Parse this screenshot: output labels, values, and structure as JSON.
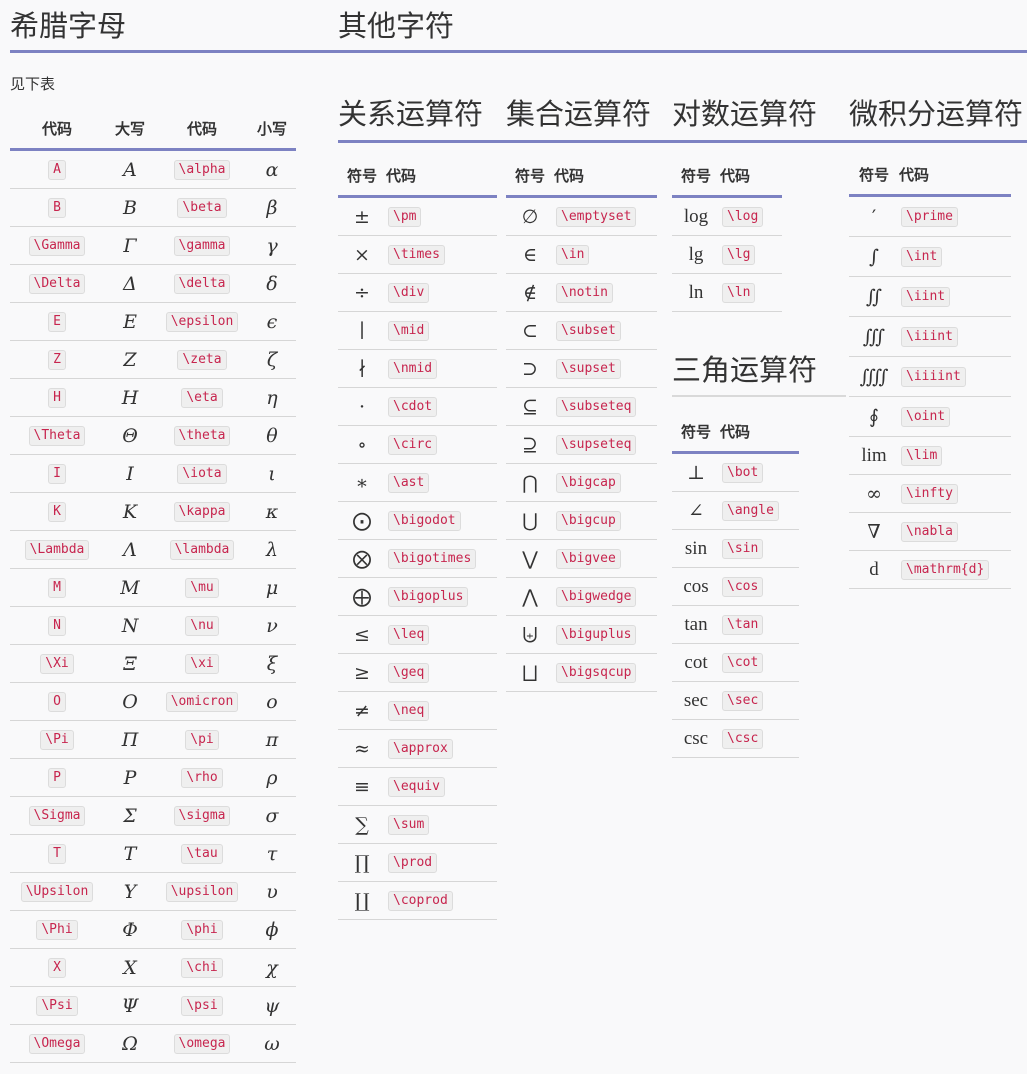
{
  "titles": {
    "greek": "希腊字母",
    "other": "其他字符",
    "relation": "关系运算符",
    "set": "集合运算符",
    "log": "对数运算符",
    "calculus": "微积分运算符",
    "trig": "三角运算符"
  },
  "greek": {
    "note": "见下表",
    "headers": [
      "代码",
      "大写",
      "代码",
      "小写"
    ],
    "rows": [
      [
        "A",
        "A",
        "\\alpha",
        "α"
      ],
      [
        "B",
        "B",
        "\\beta",
        "β"
      ],
      [
        "\\Gamma",
        "Γ",
        "\\gamma",
        "γ"
      ],
      [
        "\\Delta",
        "Δ",
        "\\delta",
        "δ"
      ],
      [
        "E",
        "E",
        "\\epsilon",
        "ϵ"
      ],
      [
        "Z",
        "Z",
        "\\zeta",
        "ζ"
      ],
      [
        "H",
        "H",
        "\\eta",
        "η"
      ],
      [
        "\\Theta",
        "Θ",
        "\\theta",
        "θ"
      ],
      [
        "I",
        "I",
        "\\iota",
        "ι"
      ],
      [
        "K",
        "K",
        "\\kappa",
        "κ"
      ],
      [
        "\\Lambda",
        "Λ",
        "\\lambda",
        "λ"
      ],
      [
        "M",
        "M",
        "\\mu",
        "μ"
      ],
      [
        "N",
        "N",
        "\\nu",
        "ν"
      ],
      [
        "\\Xi",
        "Ξ",
        "\\xi",
        "ξ"
      ],
      [
        "O",
        "O",
        "\\omicron",
        "ο"
      ],
      [
        "\\Pi",
        "Π",
        "\\pi",
        "π"
      ],
      [
        "P",
        "P",
        "\\rho",
        "ρ"
      ],
      [
        "\\Sigma",
        "Σ",
        "\\sigma",
        "σ"
      ],
      [
        "T",
        "T",
        "\\tau",
        "τ"
      ],
      [
        "\\Upsilon",
        "Υ",
        "\\upsilon",
        "υ"
      ],
      [
        "\\Phi",
        "Φ",
        "\\phi",
        "ϕ"
      ],
      [
        "X",
        "X",
        "\\chi",
        "χ"
      ],
      [
        "\\Psi",
        "Ψ",
        "\\psi",
        "ψ"
      ],
      [
        "\\Omega",
        "Ω",
        "\\omega",
        "ω"
      ]
    ]
  },
  "relation": {
    "headers": [
      "符号",
      "代码"
    ],
    "rows": [
      [
        "±",
        "\\pm"
      ],
      [
        "×",
        "\\times"
      ],
      [
        "÷",
        "\\div"
      ],
      [
        "∣",
        "\\mid"
      ],
      [
        "∤",
        "\\nmid"
      ],
      [
        "⋅",
        "\\cdot"
      ],
      [
        "∘",
        "\\circ"
      ],
      [
        "∗",
        "\\ast"
      ],
      [
        "⨀",
        "\\bigodot"
      ],
      [
        "⨂",
        "\\bigotimes"
      ],
      [
        "⨁",
        "\\bigoplus"
      ],
      [
        "≤",
        "\\leq"
      ],
      [
        "≥",
        "\\geq"
      ],
      [
        "≠",
        "\\neq"
      ],
      [
        "≈",
        "\\approx"
      ],
      [
        "≡",
        "\\equiv"
      ],
      [
        "∑",
        "\\sum"
      ],
      [
        "∏",
        "\\prod"
      ],
      [
        "∐",
        "\\coprod"
      ]
    ]
  },
  "set": {
    "headers": [
      "符号",
      "代码"
    ],
    "rows": [
      [
        "∅",
        "\\emptyset"
      ],
      [
        "∈",
        "\\in"
      ],
      [
        "∉",
        "\\notin"
      ],
      [
        "⊂",
        "\\subset"
      ],
      [
        "⊃",
        "\\supset"
      ],
      [
        "⊆",
        "\\subseteq"
      ],
      [
        "⊇",
        "\\supseteq"
      ],
      [
        "⋂",
        "\\bigcap"
      ],
      [
        "⋃",
        "\\bigcup"
      ],
      [
        "⋁",
        "\\bigvee"
      ],
      [
        "⋀",
        "\\bigwedge"
      ],
      [
        "⨄",
        "\\biguplus"
      ],
      [
        "⨆",
        "\\bigsqcup"
      ]
    ]
  },
  "log": {
    "headers": [
      "符号",
      "代码"
    ],
    "rows": [
      [
        "log",
        "\\log"
      ],
      [
        "lg",
        "\\lg"
      ],
      [
        "ln",
        "\\ln"
      ]
    ]
  },
  "trig": {
    "headers": [
      "符号",
      "代码"
    ],
    "rows": [
      [
        "⊥",
        "\\bot"
      ],
      [
        "∠",
        "\\angle"
      ],
      [
        "sin",
        "\\sin"
      ],
      [
        "cos",
        "\\cos"
      ],
      [
        "tan",
        "\\tan"
      ],
      [
        "cot",
        "\\cot"
      ],
      [
        "sec",
        "\\sec"
      ],
      [
        "csc",
        "\\csc"
      ]
    ]
  },
  "calculus": {
    "headers": [
      "符号",
      "代码"
    ],
    "rows": [
      [
        "′",
        "\\prime"
      ],
      [
        "∫",
        "\\int"
      ],
      [
        "∬",
        "\\iint"
      ],
      [
        "∭",
        "\\iiint"
      ],
      [
        "⨌",
        "\\iiiint"
      ],
      [
        "∮",
        "\\oint"
      ],
      [
        "lim",
        "\\lim"
      ],
      [
        "∞",
        "\\infty"
      ],
      [
        "∇",
        "\\nabla"
      ],
      [
        "d",
        "\\mathrm{d}"
      ]
    ]
  }
}
